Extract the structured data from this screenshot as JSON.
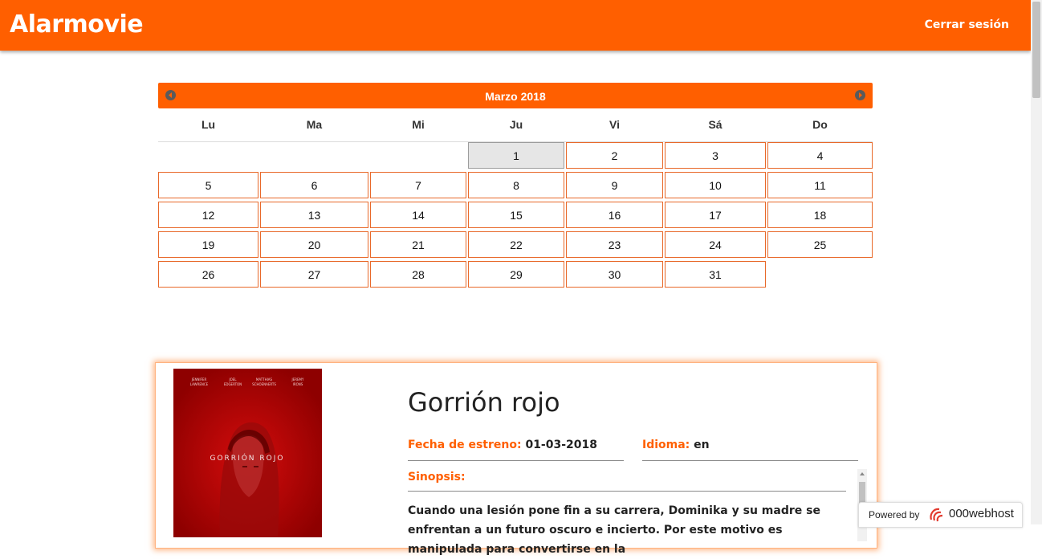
{
  "app": {
    "title": "Alarmovie",
    "logout_label": "Cerrar sesión"
  },
  "calendar": {
    "month_label": "Marzo 2018",
    "weekdays": [
      "Lu",
      "Ma",
      "Mi",
      "Ju",
      "Vi",
      "Sá",
      "Do"
    ],
    "first_weekday_index": 3,
    "days_in_month": 31,
    "today": 1,
    "colors": {
      "accent": "#ff5f00",
      "today_bg": "#e6e6e6"
    }
  },
  "movie": {
    "title": "Gorrión rojo",
    "release_label": "Fecha de estreno:",
    "release_date": "01-03-2018",
    "language_label": "Idioma:",
    "language": "en",
    "synopsis_label": "Sinopsis:",
    "synopsis": "Cuando una lesión pone fin a su carrera, Dominika y su madre se enfrentan a un futuro oscuro e incierto. Por este motivo es manipulada para convertirse en la",
    "poster": {
      "title": "GORRIÓN ROJO",
      "credits": [
        "JENNIFER LAWRENCE",
        "JOEL EDGERTON",
        "MATTHIAS SCHOENAERTS",
        "JEREMY IRONS"
      ]
    }
  },
  "footer": {
    "powered_by": "Powered by",
    "host": "000webhost"
  }
}
